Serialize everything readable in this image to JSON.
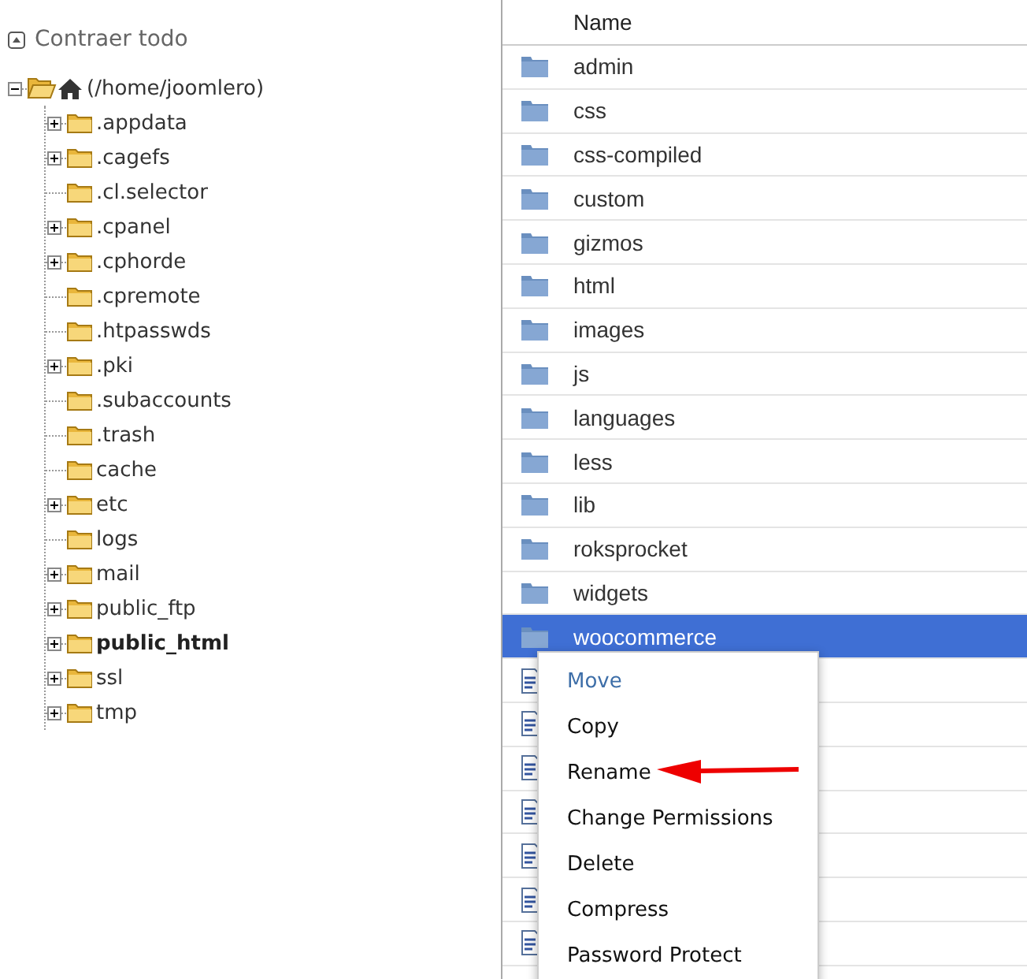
{
  "tree_header": {
    "label": "Contraer todo"
  },
  "tree": {
    "label": "(/home/joomlero)",
    "expanded": true,
    "children": [
      {
        "label": ".appdata",
        "has_children": true,
        "current": false
      },
      {
        "label": ".cagefs",
        "has_children": true,
        "current": false
      },
      {
        "label": ".cl.selector",
        "has_children": false,
        "current": false
      },
      {
        "label": ".cpanel",
        "has_children": true,
        "current": false
      },
      {
        "label": ".cphorde",
        "has_children": true,
        "current": false
      },
      {
        "label": ".cpremote",
        "has_children": false,
        "current": false
      },
      {
        "label": ".htpasswds",
        "has_children": false,
        "current": false
      },
      {
        "label": ".pki",
        "has_children": true,
        "current": false
      },
      {
        "label": ".subaccounts",
        "has_children": false,
        "current": false
      },
      {
        "label": ".trash",
        "has_children": false,
        "current": false
      },
      {
        "label": "cache",
        "has_children": false,
        "current": false
      },
      {
        "label": "etc",
        "has_children": true,
        "current": false
      },
      {
        "label": "logs",
        "has_children": false,
        "current": false
      },
      {
        "label": "mail",
        "has_children": true,
        "current": false
      },
      {
        "label": "public_ftp",
        "has_children": true,
        "current": false
      },
      {
        "label": "public_html",
        "has_children": true,
        "current": true
      },
      {
        "label": "ssl",
        "has_children": true,
        "current": false
      },
      {
        "label": "tmp",
        "has_children": true,
        "current": false
      }
    ]
  },
  "table": {
    "columns": [
      "Name"
    ],
    "rows": [
      {
        "kind": "folder",
        "name": "admin",
        "selected": false
      },
      {
        "kind": "folder",
        "name": "css",
        "selected": false
      },
      {
        "kind": "folder",
        "name": "css-compiled",
        "selected": false
      },
      {
        "kind": "folder",
        "name": "custom",
        "selected": false
      },
      {
        "kind": "folder",
        "name": "gizmos",
        "selected": false
      },
      {
        "kind": "folder",
        "name": "html",
        "selected": false
      },
      {
        "kind": "folder",
        "name": "images",
        "selected": false
      },
      {
        "kind": "folder",
        "name": "js",
        "selected": false
      },
      {
        "kind": "folder",
        "name": "languages",
        "selected": false
      },
      {
        "kind": "folder",
        "name": "less",
        "selected": false
      },
      {
        "kind": "folder",
        "name": "lib",
        "selected": false
      },
      {
        "kind": "folder",
        "name": "roksprocket",
        "selected": false
      },
      {
        "kind": "folder",
        "name": "widgets",
        "selected": false
      },
      {
        "kind": "folder",
        "name": "woocommerce",
        "selected": true
      },
      {
        "kind": "php",
        "selected": false
      },
      {
        "kind": "php",
        "selected": false
      },
      {
        "kind": "php",
        "selected": false
      },
      {
        "kind": "php",
        "selected": false
      },
      {
        "kind": "php",
        "selected": false
      },
      {
        "kind": "php",
        "selected": false
      },
      {
        "kind": "php",
        "selected": false
      }
    ]
  },
  "context_menu": {
    "items": [
      {
        "label": "Move",
        "highlighted": true
      },
      {
        "label": "Copy",
        "highlighted": false
      },
      {
        "label": "Rename",
        "highlighted": false
      },
      {
        "label": "Change Permissions",
        "highlighted": false
      },
      {
        "label": "Delete",
        "highlighted": false
      },
      {
        "label": "Compress",
        "highlighted": false
      },
      {
        "label": "Password Protect",
        "highlighted": false
      }
    ]
  }
}
